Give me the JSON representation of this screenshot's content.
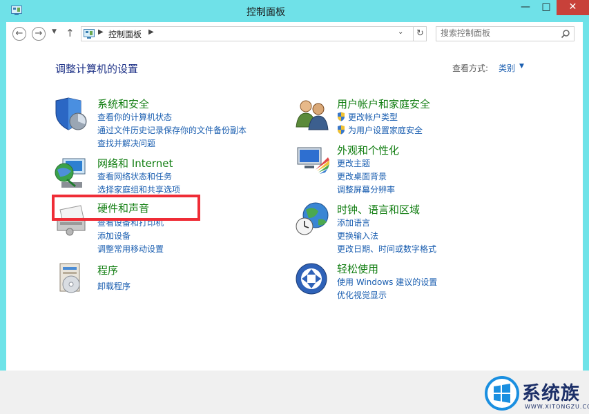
{
  "window": {
    "title": "控制面板",
    "minimize": "—",
    "maximize": "□",
    "close": "✕"
  },
  "nav": {
    "back": "←",
    "forward": "→",
    "recent": "▼",
    "up": "↑",
    "address": "控制面板",
    "address_sep": "▶",
    "dropdown": "⌄",
    "refresh": "↻",
    "search_placeholder": "搜索控制面板"
  },
  "header": {
    "heading": "调整计算机的设置",
    "view_by_label": "查看方式:",
    "view_by_value": "类别",
    "view_by_arrow": "▼"
  },
  "categories": [
    {
      "title": "系统和安全",
      "icon": "shield-icon",
      "links": [
        "查看你的计算机状态",
        "通过文件历史记录保存你的文件备份副本",
        "查找并解决问题"
      ]
    },
    {
      "title": "网络和 Internet",
      "icon": "network-icon",
      "links": [
        "查看网络状态和任务",
        "选择家庭组和共享选项"
      ]
    },
    {
      "title": "硬件和声音",
      "icon": "printer-icon",
      "links": [
        "查看设备和打印机",
        "添加设备",
        "调整常用移动设置"
      ]
    },
    {
      "title": "程序",
      "icon": "programs-icon",
      "links": [
        "卸载程序"
      ]
    },
    {
      "title": "用户帐户和家庭安全",
      "icon": "users-icon",
      "links": [
        "更改帐户类型",
        "为用户设置家庭安全"
      ]
    },
    {
      "title": "外观和个性化",
      "icon": "appearance-icon",
      "links": [
        "更改主题",
        "更改桌面背景",
        "调整屏幕分辨率"
      ]
    },
    {
      "title": "时钟、语言和区域",
      "icon": "clock-globe-icon",
      "links": [
        "添加语言",
        "更换输入法",
        "更改日期、时间或数字格式"
      ]
    },
    {
      "title": "轻松使用",
      "icon": "ease-of-access-icon",
      "links": [
        "使用 Windows 建议的设置",
        "优化视觉显示"
      ]
    }
  ],
  "watermark": {
    "text": "系统族",
    "url": "WWW.XITONGZU.COM"
  },
  "colors": {
    "titlebar": "#6fe1e8",
    "close": "#c8413a",
    "category_title": "#107d10",
    "link": "#1a5eb0",
    "heading": "#1e3287",
    "highlight": "#ef2c36"
  }
}
